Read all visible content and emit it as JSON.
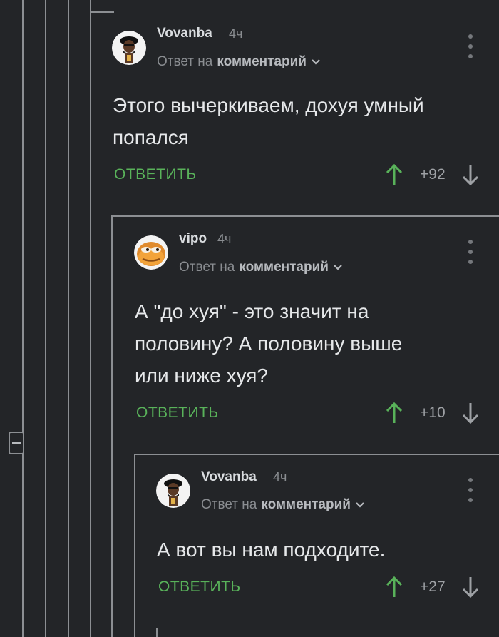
{
  "comments": [
    {
      "username": "Vovanba",
      "time": "4ч",
      "reply_prefix": "Ответ на",
      "reply_link": "комментарий",
      "body_lines": [
        "Этого вычеркиваем, дохуя умный",
        "попался"
      ],
      "reply_label": "ОТВЕТИТЬ",
      "rating": "+92",
      "avatar": "black-beret-avatar-icon"
    },
    {
      "username": "vipo",
      "time": "4ч",
      "reply_prefix": "Ответ на",
      "reply_link": "комментарий",
      "body_lines": [
        "А \"до хуя\" - это значит на",
        "половину? А половину выше",
        "или ниже хуя?"
      ],
      "reply_label": "ОТВЕТИТЬ",
      "rating": "+10",
      "avatar": "pepe-frog-avatar-icon"
    },
    {
      "username": "Vovanba",
      "time": "4ч",
      "reply_prefix": "Ответ на",
      "reply_link": "комментарий",
      "body_lines": [
        "А вот вы нам подходите."
      ],
      "reply_label": "ОТВЕТИТЬ",
      "rating": "+27",
      "avatar": "black-beret-avatar-icon"
    }
  ],
  "colors": {
    "background": "#232528",
    "thread_line": "#8c8f93",
    "accent_green": "#59b25a",
    "text": "#e6e8ea",
    "muted": "#8a8d91"
  }
}
